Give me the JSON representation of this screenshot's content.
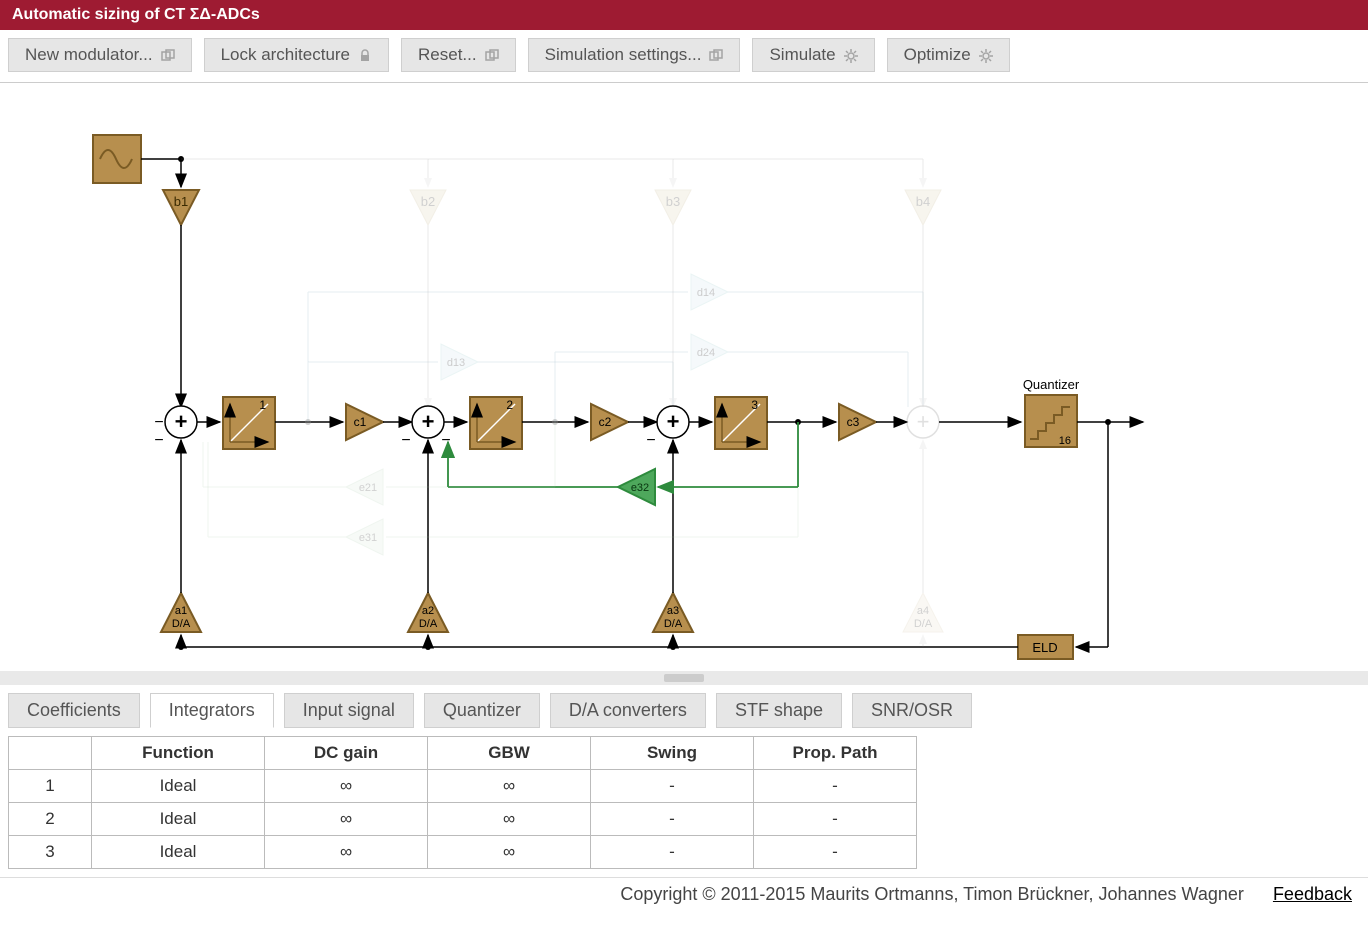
{
  "header": {
    "title": "Automatic sizing of CT ΣΔ-ADCs"
  },
  "toolbar": {
    "new_modulator": "New modulator...",
    "lock_architecture": "Lock architecture",
    "reset": "Reset...",
    "simulation_settings": "Simulation settings...",
    "simulate": "Simulate",
    "optimize": "Optimize"
  },
  "diagram": {
    "quantizer_label": "Quantizer",
    "quantizer_levels": "16",
    "eld_label": "ELD",
    "integrators": [
      {
        "index": "1",
        "c_label": "c1",
        "a_label": "a1",
        "b_label": "b1",
        "da_label": "D/A"
      },
      {
        "index": "2",
        "c_label": "c2",
        "a_label": "a2",
        "b_label": "b2",
        "da_label": "D/A"
      },
      {
        "index": "3",
        "c_label": "c3",
        "a_label": "a3",
        "b_label": "b3",
        "da_label": "D/A"
      }
    ],
    "faded": {
      "b4": "b4",
      "a4_label": "a4",
      "a4_da": "D/A",
      "d13": "d13",
      "d14": "d14",
      "d24": "d24",
      "e21": "e21",
      "e31": "e31"
    },
    "e32_label": "e32",
    "sum_minus": "−",
    "sum_plus": "+"
  },
  "tabs": {
    "items": [
      "Coefficients",
      "Integrators",
      "Input signal",
      "Quantizer",
      "D/A converters",
      "STF shape",
      "SNR/OSR"
    ],
    "active_index": 1
  },
  "integrators_table": {
    "headers": [
      "",
      "Function",
      "DC gain",
      "GBW",
      "Swing",
      "Prop. Path"
    ],
    "rows": [
      {
        "id": "1",
        "function": "Ideal",
        "dc_gain": "∞",
        "gbw": "∞",
        "swing": "-",
        "prop": "-"
      },
      {
        "id": "2",
        "function": "Ideal",
        "dc_gain": "∞",
        "gbw": "∞",
        "swing": "-",
        "prop": "-"
      },
      {
        "id": "3",
        "function": "Ideal",
        "dc_gain": "∞",
        "gbw": "∞",
        "swing": "-",
        "prop": "-"
      }
    ]
  },
  "footer": {
    "copyright": "Copyright © 2011-2015 Maurits Ortmanns, Timon Brückner, Johannes Wagner",
    "feedback": "Feedback"
  }
}
